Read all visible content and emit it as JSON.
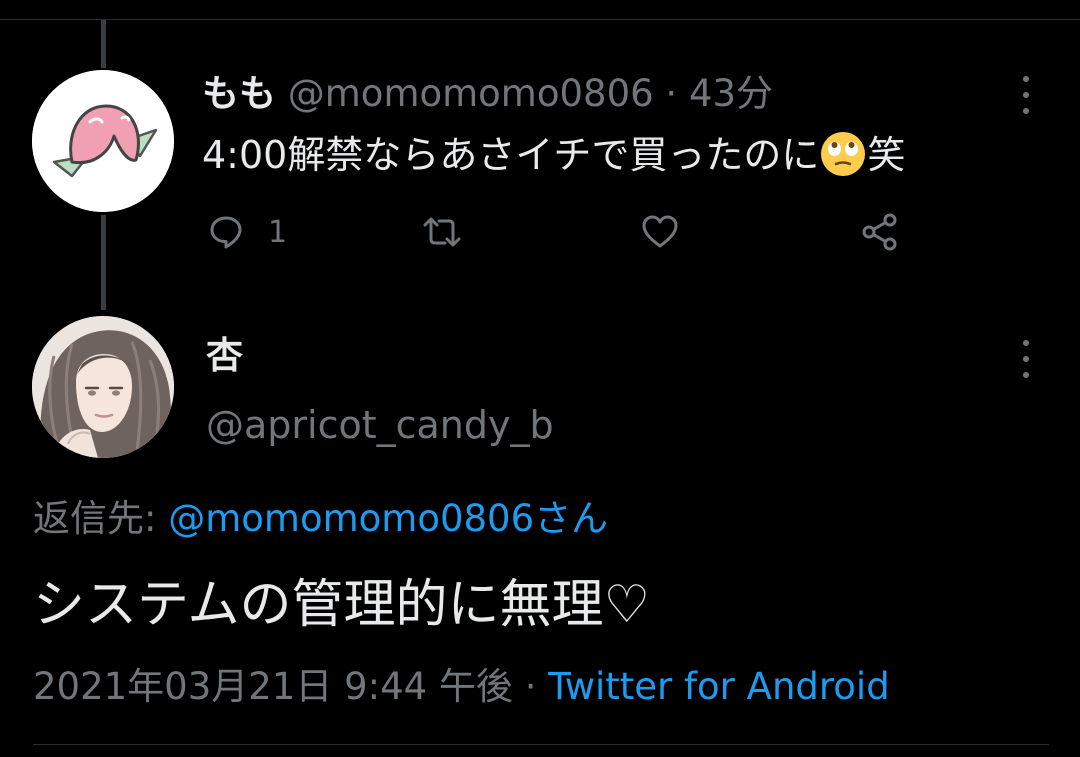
{
  "colors": {
    "background": "#000000",
    "text": "#e7e9ea",
    "muted": "#71767b",
    "link": "#1d9bf0",
    "divider": "#2a2d30"
  },
  "parent_tweet": {
    "display_name": "もも",
    "handle": "@momomomo0806",
    "separator": "·",
    "time_ago": "43分",
    "text_before_emoji": "4:00解禁ならあさイチで買ったのに",
    "emoji": "face-with-rolling-eyes-emoji",
    "text_after_emoji": "笑",
    "reply_count": "1",
    "icons": [
      "reply-icon",
      "retweet-icon",
      "like-icon",
      "share-icon",
      "more-options-icon"
    ]
  },
  "main_tweet": {
    "display_name": "杏",
    "handle": "@apricot_candy_b",
    "reply_to_label": "返信先:",
    "reply_to_handle": "@momomomo0806さん",
    "text": "システムの管理的に無理♡",
    "timestamp": "2021年03月21日 9:44 午後",
    "separator": "·",
    "source": "Twitter for Android"
  }
}
